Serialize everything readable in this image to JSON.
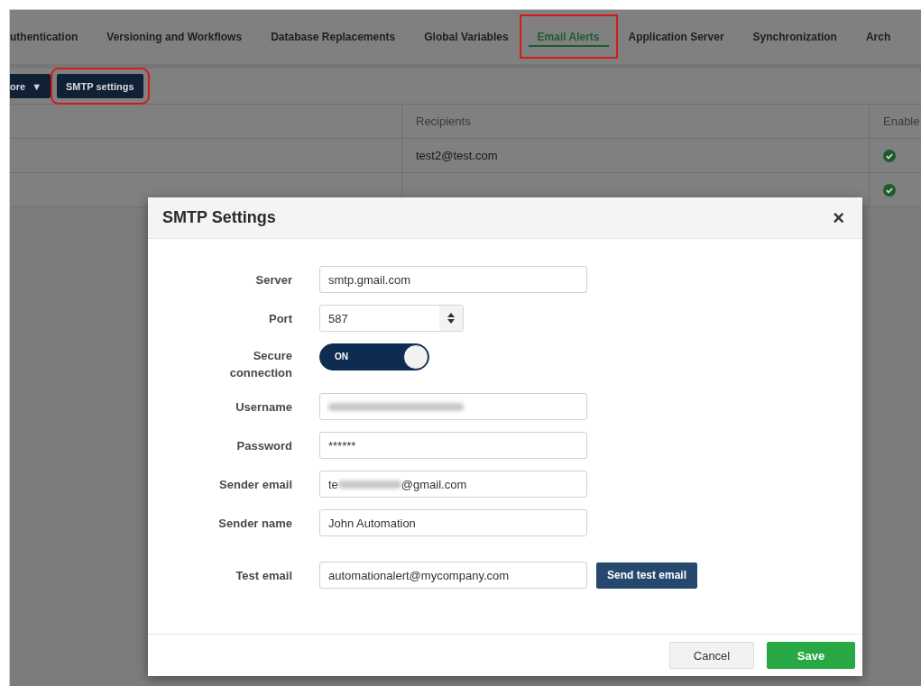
{
  "tabs": [
    {
      "label": "uthentication",
      "selected": false,
      "highlighted": false
    },
    {
      "label": "Versioning and Workflows",
      "selected": false,
      "highlighted": false
    },
    {
      "label": "Database Replacements",
      "selected": false,
      "highlighted": false
    },
    {
      "label": "Global Variables",
      "selected": false,
      "highlighted": false
    },
    {
      "label": "Email Alerts",
      "selected": true,
      "highlighted": true
    },
    {
      "label": "Application Server",
      "selected": false,
      "highlighted": false
    },
    {
      "label": "Synchronization",
      "selected": false,
      "highlighted": false
    },
    {
      "label": "Arch",
      "selected": false,
      "highlighted": false
    }
  ],
  "toolbar": [
    {
      "label": "ore",
      "kind": "dropdown",
      "caret": "▼",
      "highlighted": false
    },
    {
      "label": "SMTP settings",
      "kind": "button",
      "highlighted": true
    }
  ],
  "table": {
    "columns": [
      "Recipients",
      "Enable"
    ],
    "rows": [
      {
        "recipients": "test2@test.com",
        "enabled": true
      },
      {
        "enabled": true
      }
    ]
  },
  "dialog": {
    "title": "SMTP Settings",
    "close": "×",
    "fields": [
      {
        "label": "Server",
        "kind": "text",
        "value": "smtp.gmail.com"
      },
      {
        "label": "Port",
        "kind": "number",
        "value": "587"
      },
      {
        "label": "Secure connection",
        "kind": "toggle",
        "on": true,
        "state_text": "ON"
      },
      {
        "label": "Username",
        "kind": "redacted"
      },
      {
        "label": "Password",
        "kind": "text",
        "value": "******"
      },
      {
        "label": "Sender email",
        "kind": "partly_redacted",
        "prefix": "te",
        "suffix": "@gmail.com"
      },
      {
        "label": "Sender name",
        "kind": "text",
        "value": "John Automation"
      },
      {
        "label": "Test email",
        "kind": "test",
        "value": "automationalert@mycompany.com",
        "action": "Send test email"
      }
    ],
    "buttons": [
      {
        "label": "Cancel",
        "kind": "secondary"
      },
      {
        "label": "Save",
        "kind": "primary"
      }
    ]
  }
}
